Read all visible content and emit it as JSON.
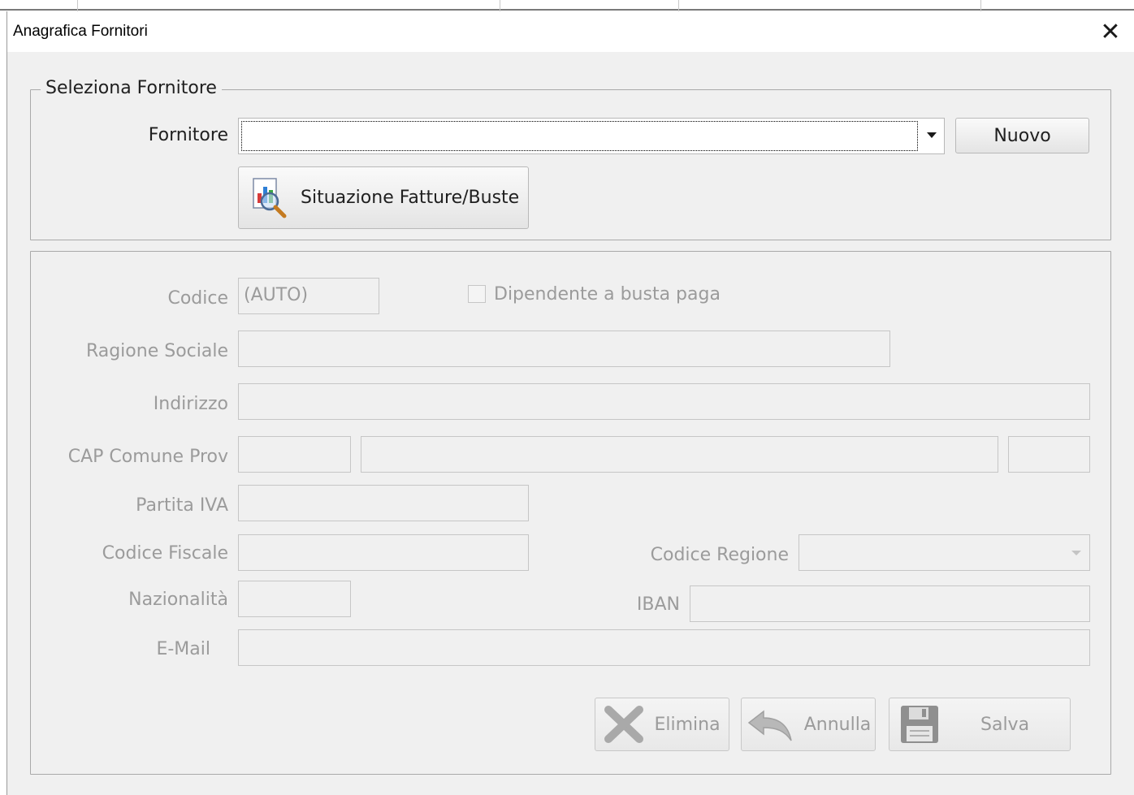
{
  "window": {
    "title": "Anagrafica Fornitori",
    "close_glyph": "✕"
  },
  "select_group": {
    "legend": "Seleziona Fornitore",
    "fornitore_label": "Fornitore",
    "fornitore_value": "",
    "new_button": "Nuovo",
    "situazione_button": "Situazione Fatture/Buste",
    "situazione_icon": "invoice-search-icon"
  },
  "form": {
    "codice_label": "Codice",
    "codice_value": "(AUTO)",
    "dipendente_label": "Dipendente a busta paga",
    "dipendente_checked": false,
    "ragione_sociale_label": "Ragione Sociale",
    "ragione_sociale_value": "",
    "indirizzo_label": "Indirizzo",
    "indirizzo_value": "",
    "cap_comune_prov_label": "CAP Comune Prov",
    "cap_value": "",
    "comune_value": "",
    "prov_value": "",
    "partita_iva_label": "Partita IVA",
    "partita_iva_value": "",
    "codice_fiscale_label": "Codice Fiscale",
    "codice_fiscale_value": "",
    "codice_regione_label": "Codice Regione",
    "codice_regione_value": "",
    "nazionalita_label": "Nazionalità",
    "nazionalita_value": "",
    "iban_label": "IBAN",
    "iban_value": "",
    "email_label": "E-Mail",
    "email_value": ""
  },
  "actions": {
    "elimina": "Elimina",
    "annulla": "Annulla",
    "salva": "Salva"
  },
  "colors": {
    "window_bg": "#f0f0f0",
    "disabled_text": "#9b9b9b",
    "active_text": "#1f1f1f"
  }
}
